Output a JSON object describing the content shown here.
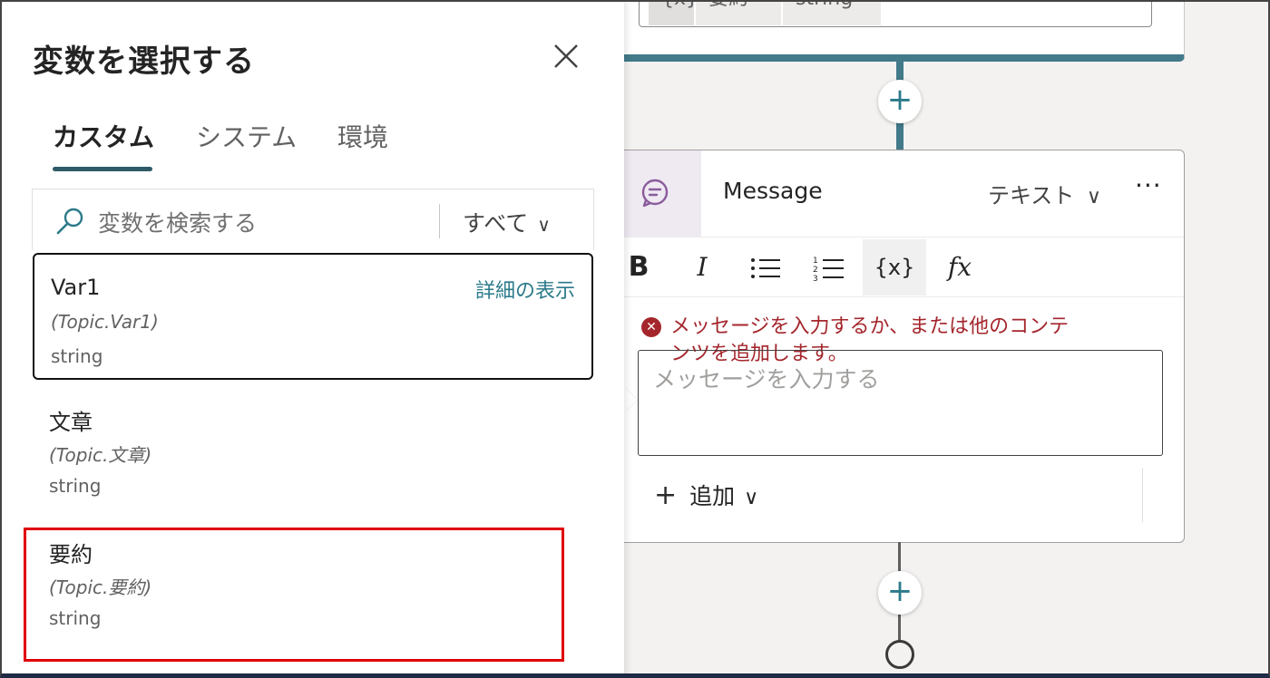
{
  "panel": {
    "title": "変数を選択する",
    "tabs": [
      {
        "label": "カスタム",
        "active": true
      },
      {
        "label": "システム",
        "active": false
      },
      {
        "label": "環境",
        "active": false
      }
    ],
    "search": {
      "placeholder": "変数を検索する",
      "filter": "すべて"
    },
    "variables": [
      {
        "name": "Var1",
        "path": "(Topic.Var1)",
        "type": "string",
        "detail_link": "詳細の表示",
        "selected": true
      },
      {
        "name": "文章",
        "path": "(Topic.文章)",
        "type": "string"
      },
      {
        "name": "要約",
        "path": "(Topic.要約)",
        "type": "string",
        "highlighted": true
      }
    ]
  },
  "canvas": {
    "top_node": {
      "chips": [
        "{x}",
        "要約",
        "string"
      ]
    },
    "message_node": {
      "title": "Message",
      "type_dropdown": "テキスト",
      "toolbar": [
        "B",
        "I",
        "bulleted-list",
        "numbered-list",
        "{x}",
        "fx"
      ],
      "error": "メッセージを入力するか、または他のコンテンツを追加します。",
      "input_placeholder": "メッセージを入力する",
      "add_label": "追加"
    }
  },
  "colors": {
    "accent": "#2b7a8a",
    "connector": "#427a8a",
    "error": "#a4262c",
    "highlight": "#e00000",
    "message_icon_bg": "#efe9f2",
    "message_icon": "#8a5c9c"
  }
}
